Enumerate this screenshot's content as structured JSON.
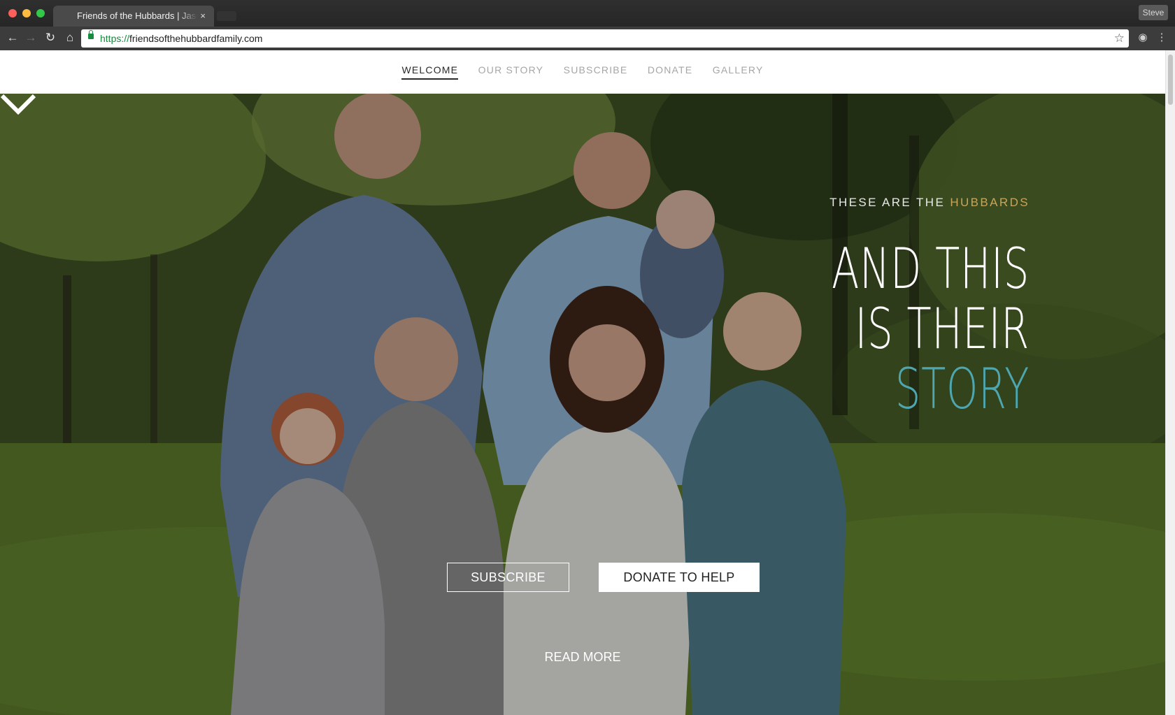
{
  "browser": {
    "tab_title": "Friends of the Hubbards | Jason",
    "tab_close": "×",
    "profile_name": "Steve",
    "url_scheme": "https://",
    "url_host": "friendsofthehubbardfamily.com",
    "icons": [
      "back-icon",
      "forward-icon",
      "reload-icon",
      "home-icon",
      "lock-icon",
      "star-icon",
      "camera-icon",
      "menu-icon"
    ]
  },
  "nav": {
    "items": [
      "WELCOME",
      "OUR STORY",
      "SUBSCRIBE",
      "DONATE",
      "GALLERY"
    ],
    "active": "WELCOME"
  },
  "hero": {
    "eyebrow_prefix": "THESE ARE THE ",
    "eyebrow_accent": "HUBBARDS",
    "headline_line1": "AND THIS",
    "headline_line2": "IS THEIR",
    "headline_line3": "STORY",
    "subscribe_label": "SUBSCRIBE",
    "donate_label": "DONATE TO HELP",
    "read_more": "READ MORE",
    "colors": {
      "teal": "#4ea7b0",
      "gold": "#c9a45a"
    }
  }
}
